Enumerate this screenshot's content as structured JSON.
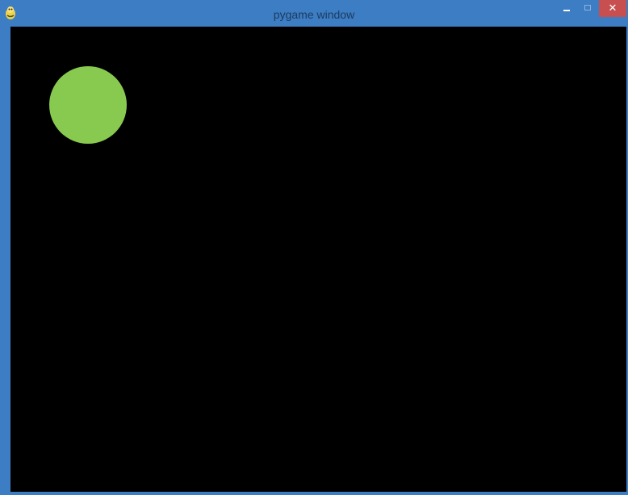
{
  "window": {
    "title": "pygame window",
    "frame_color": "#3c7dc4",
    "close_button_color": "#c74f4f",
    "controls": {
      "minimize_icon": "minimize-icon",
      "maximize_icon": "maximize-icon",
      "close_icon": "close-icon",
      "close_glyph": "✕"
    },
    "app_icon": "pygame-snake-icon"
  },
  "canvas": {
    "background": "#000000",
    "ball_color": "#88c94f"
  }
}
